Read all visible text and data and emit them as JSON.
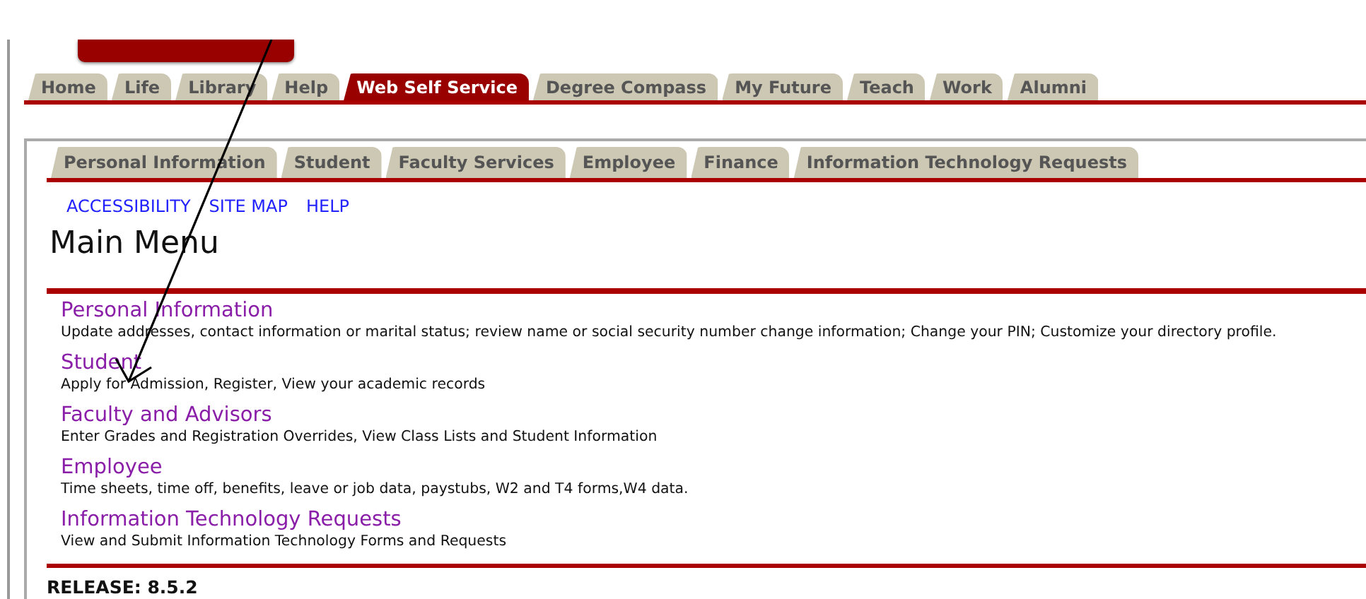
{
  "top_tabs": [
    {
      "label": "Home",
      "selected": false
    },
    {
      "label": "Life",
      "selected": false
    },
    {
      "label": "Library",
      "selected": false
    },
    {
      "label": "Help",
      "selected": false
    },
    {
      "label": "Web Self Service",
      "selected": true
    },
    {
      "label": "Degree Compass",
      "selected": false
    },
    {
      "label": "My Future",
      "selected": false
    },
    {
      "label": "Teach",
      "selected": false
    },
    {
      "label": "Work",
      "selected": false
    },
    {
      "label": "Alumni",
      "selected": false
    }
  ],
  "section_tabs": [
    {
      "label": "Personal Information",
      "selected": false
    },
    {
      "label": "Student",
      "selected": false
    },
    {
      "label": "Faculty Services",
      "selected": false
    },
    {
      "label": "Employee",
      "selected": false
    },
    {
      "label": "Finance",
      "selected": false
    },
    {
      "label": "Information Technology Requests",
      "selected": false
    }
  ],
  "utility_links": [
    "ACCESSIBILITY",
    "SITE MAP",
    "HELP"
  ],
  "page_title": "Main Menu",
  "menu_items": [
    {
      "title": "Personal Information",
      "description": "Update addresses, contact information or marital status; review name or social security number change information; Change your PIN; Customize your directory profile."
    },
    {
      "title": "Student",
      "description": "Apply for Admission, Register, View your academic records"
    },
    {
      "title": "Faculty and Advisors",
      "description": "Enter Grades and Registration Overrides, View Class Lists and Student Information"
    },
    {
      "title": "Employee",
      "description": "Time sheets, time off, benefits, leave or job data, paystubs, W2 and T4 forms,W4 data."
    },
    {
      "title": "Information Technology Requests",
      "description": "View and Submit Information Technology Forms and Requests"
    }
  ],
  "release": "RELEASE: 8.5.2"
}
